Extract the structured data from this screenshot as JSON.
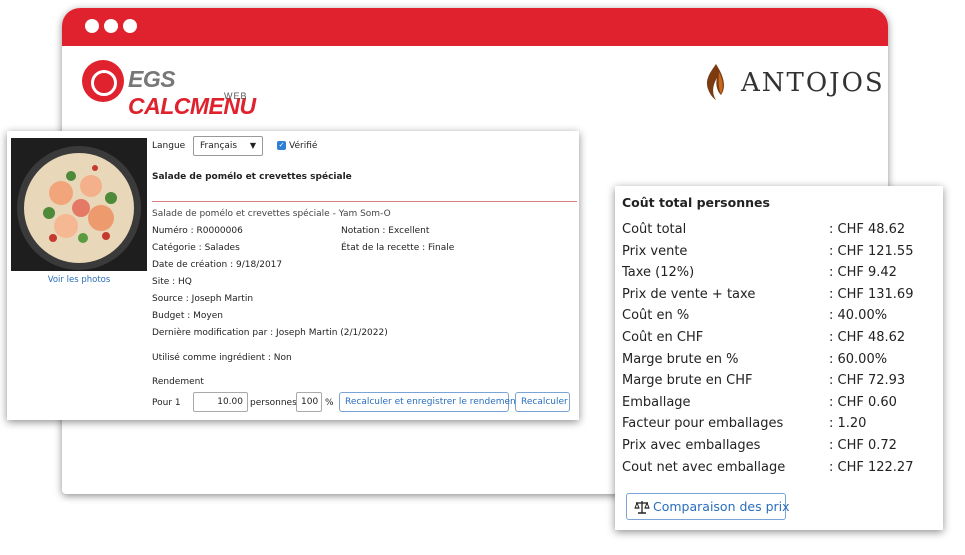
{
  "browser": {
    "dots": 3
  },
  "logos": {
    "egs_part1": "EGS ",
    "egs_part2": "CALCMENU",
    "egs_sub": "WEB",
    "antojos": "ANTOJOS"
  },
  "recipe": {
    "language_label": "Langue",
    "language_value": "Français",
    "verified_label": "Vérifié",
    "title": "Salade de pomélo et crevettes spéciale",
    "subtitle": "Salade de pomélo et crevettes spéciale - Yam Som-O",
    "photo_link": "Voir les photos",
    "numero": "Numéro : R0000006",
    "notation": "Notation : Excellent",
    "categorie": "Catégorie : Salades",
    "etat": "État de la recette : Finale",
    "date_creation": "Date de création : 9/18/2017",
    "site": "Site : HQ",
    "source": "Source : Joseph Martin",
    "budget": "Budget : Moyen",
    "derniere_modif": "Dernière modification par : Joseph Martin  (2/1/2022)",
    "utilise": "Utilisé comme ingrédient : Non",
    "rendement_label": "Rendement",
    "pour_label": "Pour 1",
    "quantity_value": "10.00",
    "personnes_label": "personnes",
    "percent_value": "100",
    "percent_sign": "%",
    "recalc_save_button": "Recalculer et enregistrer le rendement",
    "recalc_button": "Recalculer"
  },
  "cost": {
    "title": "Coût total personnes",
    "rows": [
      {
        "label": "Coût total",
        "value": ": CHF 48.62"
      },
      {
        "label": "Prix vente",
        "value": ": CHF 121.55"
      },
      {
        "label": "Taxe (12%)",
        "value": ": CHF 9.42"
      },
      {
        "label": "Prix de vente + taxe",
        "value": ": CHF 131.69"
      },
      {
        "label": "Coût en %",
        "value": ": 40.00%"
      },
      {
        "label": "Coût en CHF",
        "value": ": CHF 48.62"
      },
      {
        "label": "Marge brute en %",
        "value": ": 60.00%"
      },
      {
        "label": "Marge brute en CHF",
        "value": ": CHF 72.93"
      },
      {
        "label": "Emballage",
        "value": ": CHF 0.60"
      },
      {
        "label": "Facteur pour emballages",
        "value": ": 1.20"
      },
      {
        "label": "Prix avec emballages",
        "value": ": CHF 0.72"
      },
      {
        "label": "Cout net avec emballage",
        "value": ": CHF 122.27"
      }
    ],
    "compare_button": "Comparaison des prix"
  },
  "colors": {
    "brand_red": "#e0212e",
    "link_blue": "#2a6ebb"
  }
}
